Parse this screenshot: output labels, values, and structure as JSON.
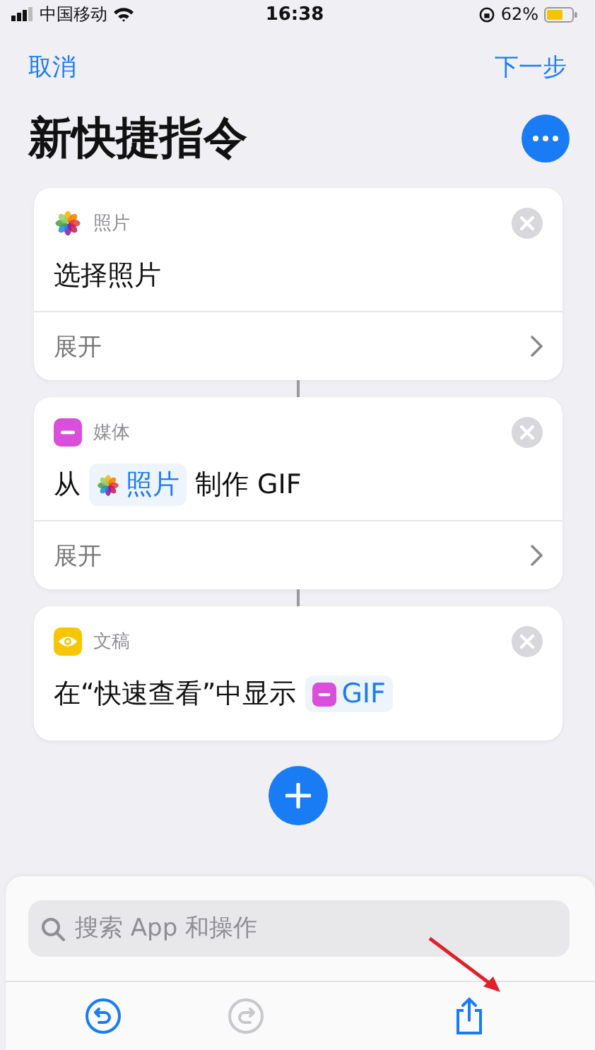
{
  "status_bar": {
    "carrier": "中国移动",
    "time": "16:38",
    "battery": "62%"
  },
  "nav": {
    "cancel": "取消",
    "next": "下一步"
  },
  "title": "新快捷指令",
  "actions": [
    {
      "kind": "photos",
      "category": "照片",
      "parts": [
        {
          "kind": "text",
          "text": "选择照片"
        }
      ],
      "expand": "展开"
    },
    {
      "kind": "media",
      "category": "媒体",
      "parts": [
        {
          "kind": "text",
          "text": "从"
        },
        {
          "kind": "photos",
          "text": "照片"
        },
        {
          "kind": "text",
          "text": "制作 GIF"
        }
      ],
      "expand": "展开"
    },
    {
      "kind": "eye",
      "category": "文稿",
      "parts": [
        {
          "kind": "text",
          "text": "在“快速查看”中显示"
        },
        {
          "kind": "media",
          "text": "GIF"
        }
      ]
    }
  ],
  "search": {
    "placeholder": "搜索 App 和操作"
  },
  "toolbar": [
    {
      "kind": "undo",
      "disabled": false
    },
    {
      "kind": "redo",
      "disabled": true
    },
    {
      "kind": "share",
      "disabled": false
    }
  ]
}
